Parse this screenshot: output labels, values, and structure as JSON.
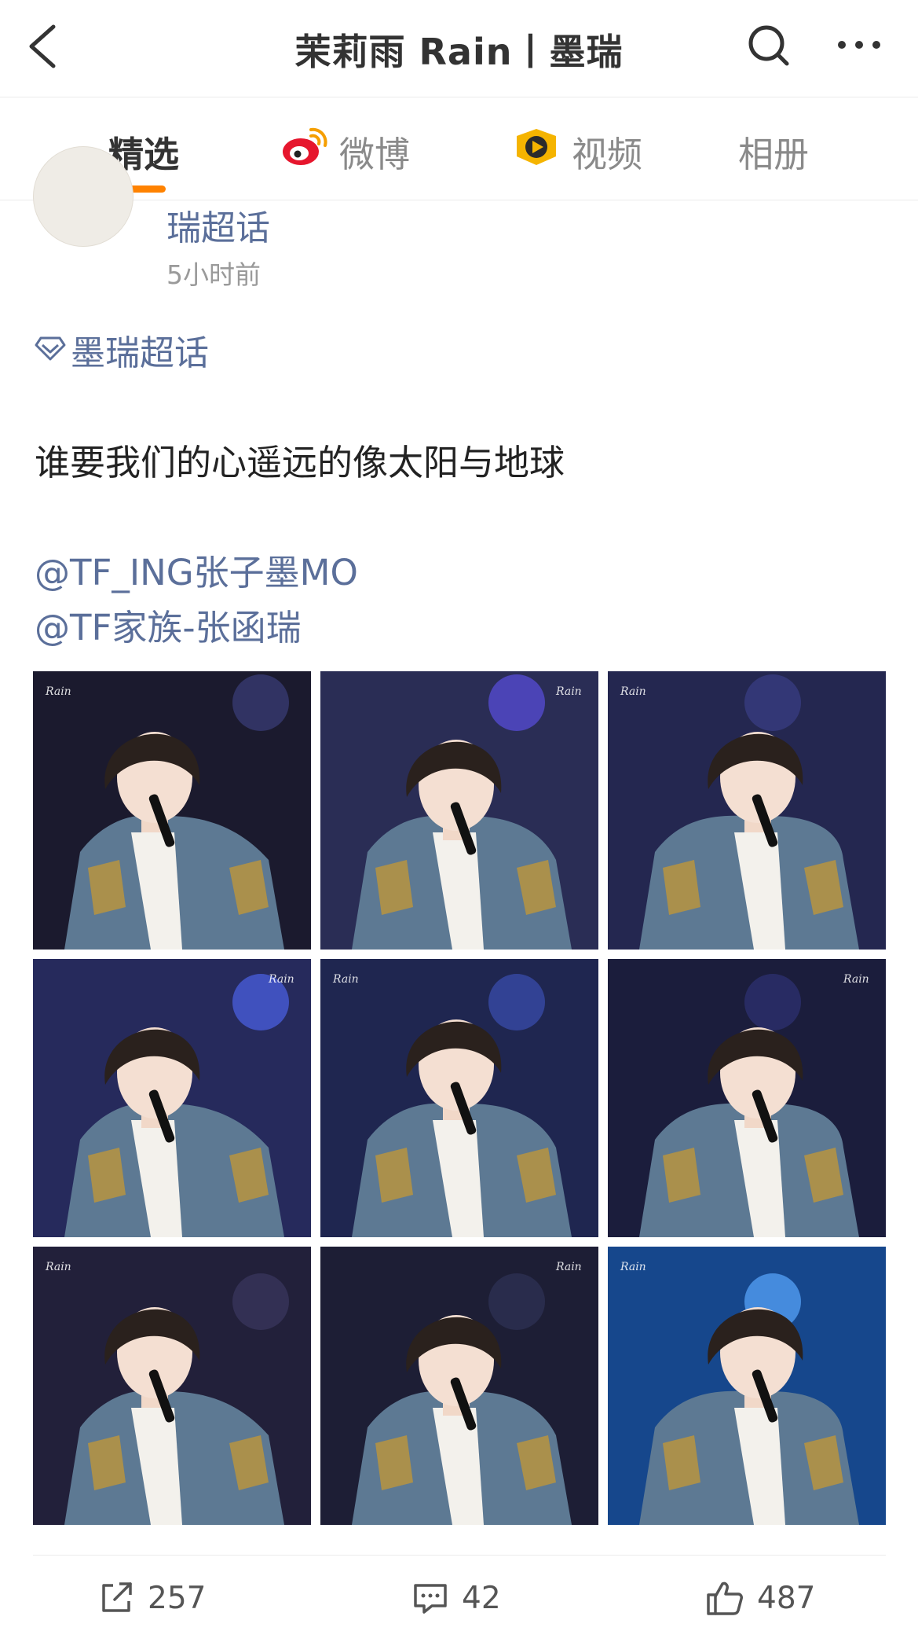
{
  "header": {
    "title": "茉莉雨 Rain丨墨瑞",
    "back_icon": "chevron-left-icon",
    "search_icon": "search-icon",
    "more_icon": "more-horizontal-icon"
  },
  "tabs": [
    {
      "label": "精选",
      "active": true
    },
    {
      "label": "微博",
      "icon": "weibo-logo-icon"
    },
    {
      "label": "视频",
      "icon": "video-play-icon"
    },
    {
      "label": "相册"
    }
  ],
  "post": {
    "author": "瑞超话",
    "time": "5小时前",
    "topic": "墨瑞超话",
    "text": "谁要我们的心遥远的像太阳与地球",
    "mentions": [
      "@TF_ING张子墨MO",
      "@TF家族-张函瑞"
    ],
    "photo_watermark": "Rain",
    "photo_count": 9
  },
  "actions": {
    "repost_count": "257",
    "comment_count": "42",
    "like_count": "487"
  },
  "colors": {
    "accent": "#ff8200",
    "link": "#5b6f9a",
    "muted": "#9a9a9a"
  }
}
